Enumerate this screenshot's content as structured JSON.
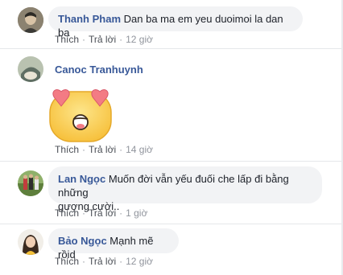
{
  "comments": [
    {
      "author": "Thanh Pham",
      "text": "Dan ba ma em yeu duoimoi la dan ba",
      "actions": {
        "like": "Thích",
        "reply": "Trả lời",
        "time": "12 giờ"
      }
    },
    {
      "author": "Canoc Tranhuynh",
      "sticker": "heart-eyes-emoji-sticker",
      "actions": {
        "like": "Thích",
        "reply": "Trả lời",
        "time": "14 giờ"
      }
    },
    {
      "author": "Lan Ngọc",
      "text_line1": "Muốn đời vẫn yếu đuối che lấp đi bằng những",
      "text_line2": "gượng cười..",
      "actions": {
        "like": "Thích",
        "reply": "Trả lời",
        "time": "1 giờ"
      }
    },
    {
      "author": "Bảo Ngọc",
      "text": "Mạnh mẽ rồid",
      "actions": {
        "like": "Thích",
        "reply": "Trả lời",
        "time": "12 giờ"
      }
    }
  ],
  "colors": {
    "author": "#385898",
    "bubble": "#f2f3f5",
    "meta": "#90949c",
    "sticker_face": "#fbd25f",
    "sticker_heart": "#f37b84"
  }
}
